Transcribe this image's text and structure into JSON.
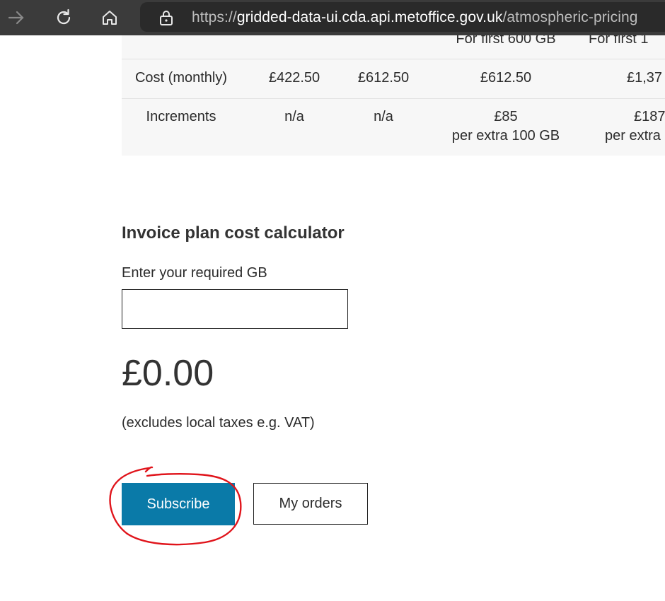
{
  "browser": {
    "url_scheme": "https://",
    "url_host": "gridded-data-ui.cda.api.metoffice.gov.uk",
    "url_path": "/atmospheric-pricing"
  },
  "table": {
    "partial_header": [
      "For first 600 GB",
      "For first 1"
    ],
    "cost_row": {
      "label": "Cost (monthly)",
      "values": [
        "£422.50",
        "£612.50",
        "£612.50",
        "£1,37"
      ]
    },
    "increments_row": {
      "label": "Increments",
      "values": [
        {
          "line1": "n/a",
          "line2": ""
        },
        {
          "line1": "n/a",
          "line2": ""
        },
        {
          "line1": "£85",
          "line2": "per extra 100 GB"
        },
        {
          "line1": "£187",
          "line2": "per extra"
        }
      ]
    }
  },
  "calculator": {
    "title": "Invoice plan cost calculator",
    "input_label": "Enter your required GB",
    "input_value": "",
    "total": "£0.00",
    "tax_note": "(excludes local taxes e.g. VAT)"
  },
  "actions": {
    "subscribe_label": "Subscribe",
    "orders_label": "My orders"
  },
  "colors": {
    "subscribe_bg": "#0a7aa8",
    "annotation": "#e0141b"
  }
}
